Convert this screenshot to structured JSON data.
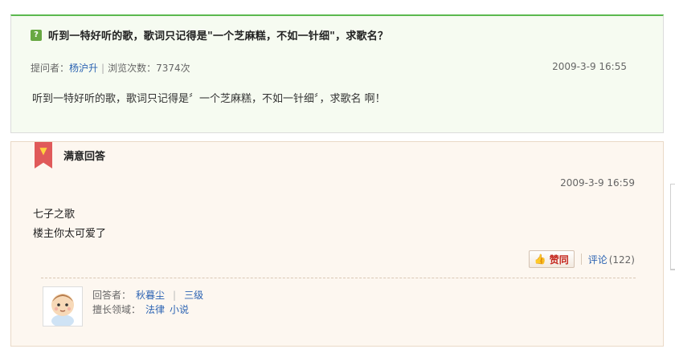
{
  "question": {
    "badge": "?",
    "title": "听到一特好听的歌，歌词只记得是\"一个芝麻糕，不如一针细\"，求歌名？",
    "meta": {
      "asker_label": "提问者：",
      "asker_name": "杨沪升",
      "views_label": "浏览次数：",
      "views_count": "7374次"
    },
    "date": "2009-3-9 16:55",
    "body": "听到一特好听的歌，歌词只记得是〞一个芝麻糕，不如一针细〞，求歌名 啊！"
  },
  "answer": {
    "label": "满意回答",
    "date": "2009-3-9 16:59",
    "lines": [
      "七子之歌",
      "楼主你太可爱了"
    ],
    "agree_label": "赞同",
    "comment_label": "评论",
    "comment_count": "(122)",
    "answerer": {
      "name_label": "回答者：",
      "name": "秋暮尘",
      "level": "三级",
      "specialty_label": "擅长领域：",
      "specialties": [
        "法律",
        "小说"
      ]
    }
  },
  "colors": {
    "green_accent": "#5bb84e",
    "link_blue": "#2d64b3",
    "ribbon_red": "#e05a5a"
  }
}
